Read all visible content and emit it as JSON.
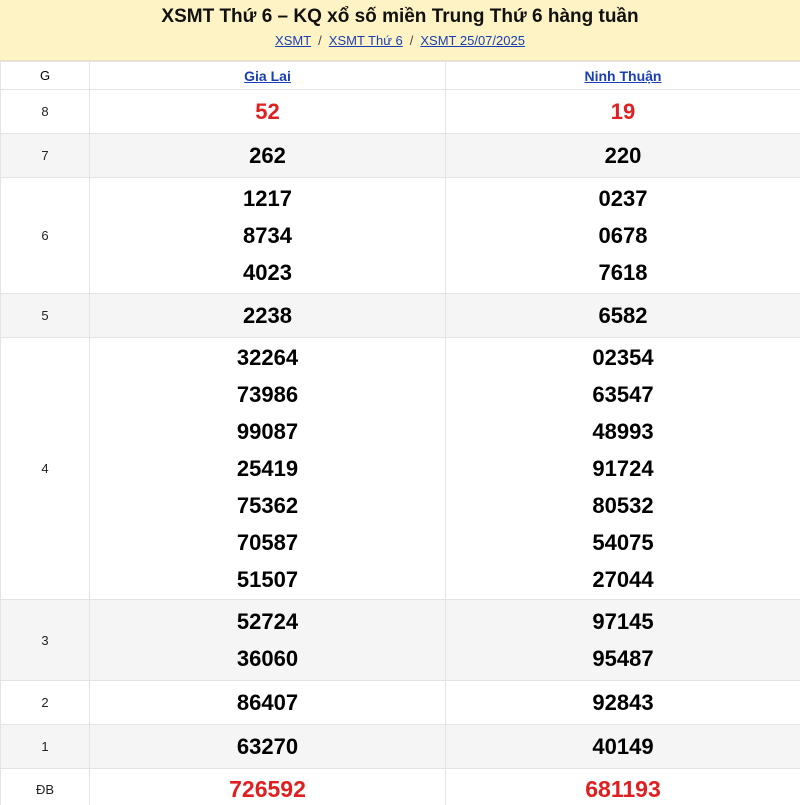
{
  "header": {
    "title": "XSMT Thứ 6 – KQ xổ số miền Trung Thứ 6 hàng tuần",
    "breadcrumb": [
      "XSMT",
      "XSMT Thứ 6",
      "XSMT 25/07/2025"
    ],
    "separator": "/",
    "background_color": "#fdf3c4",
    "link_color": "#1a3fb5"
  },
  "table": {
    "col_header": "G",
    "provinces": [
      "Gia Lai",
      "Ninh Thuận"
    ],
    "highlight_color": "#e02020",
    "rows": {
      "g8": {
        "label": "8",
        "gia_lai": [
          "52"
        ],
        "ninh_thuan": [
          "19"
        ]
      },
      "g7": {
        "label": "7",
        "gia_lai": [
          "262"
        ],
        "ninh_thuan": [
          "220"
        ]
      },
      "g6": {
        "label": "6",
        "gia_lai": [
          "1217",
          "8734",
          "4023"
        ],
        "ninh_thuan": [
          "0237",
          "0678",
          "7618"
        ]
      },
      "g5": {
        "label": "5",
        "gia_lai": [
          "2238"
        ],
        "ninh_thuan": [
          "6582"
        ]
      },
      "g4": {
        "label": "4",
        "gia_lai": [
          "32264",
          "73986",
          "99087",
          "25419",
          "75362",
          "70587",
          "51507"
        ],
        "ninh_thuan": [
          "02354",
          "63547",
          "48993",
          "91724",
          "80532",
          "54075",
          "27044"
        ]
      },
      "g3": {
        "label": "3",
        "gia_lai": [
          "52724",
          "36060"
        ],
        "ninh_thuan": [
          "97145",
          "95487"
        ]
      },
      "g2": {
        "label": "2",
        "gia_lai": [
          "86407"
        ],
        "ninh_thuan": [
          "92843"
        ]
      },
      "g1": {
        "label": "1",
        "gia_lai": [
          "63270"
        ],
        "ninh_thuan": [
          "40149"
        ]
      },
      "db": {
        "label": "ĐB",
        "gia_lai": [
          "726592"
        ],
        "ninh_thuan": [
          "681193"
        ]
      }
    }
  }
}
